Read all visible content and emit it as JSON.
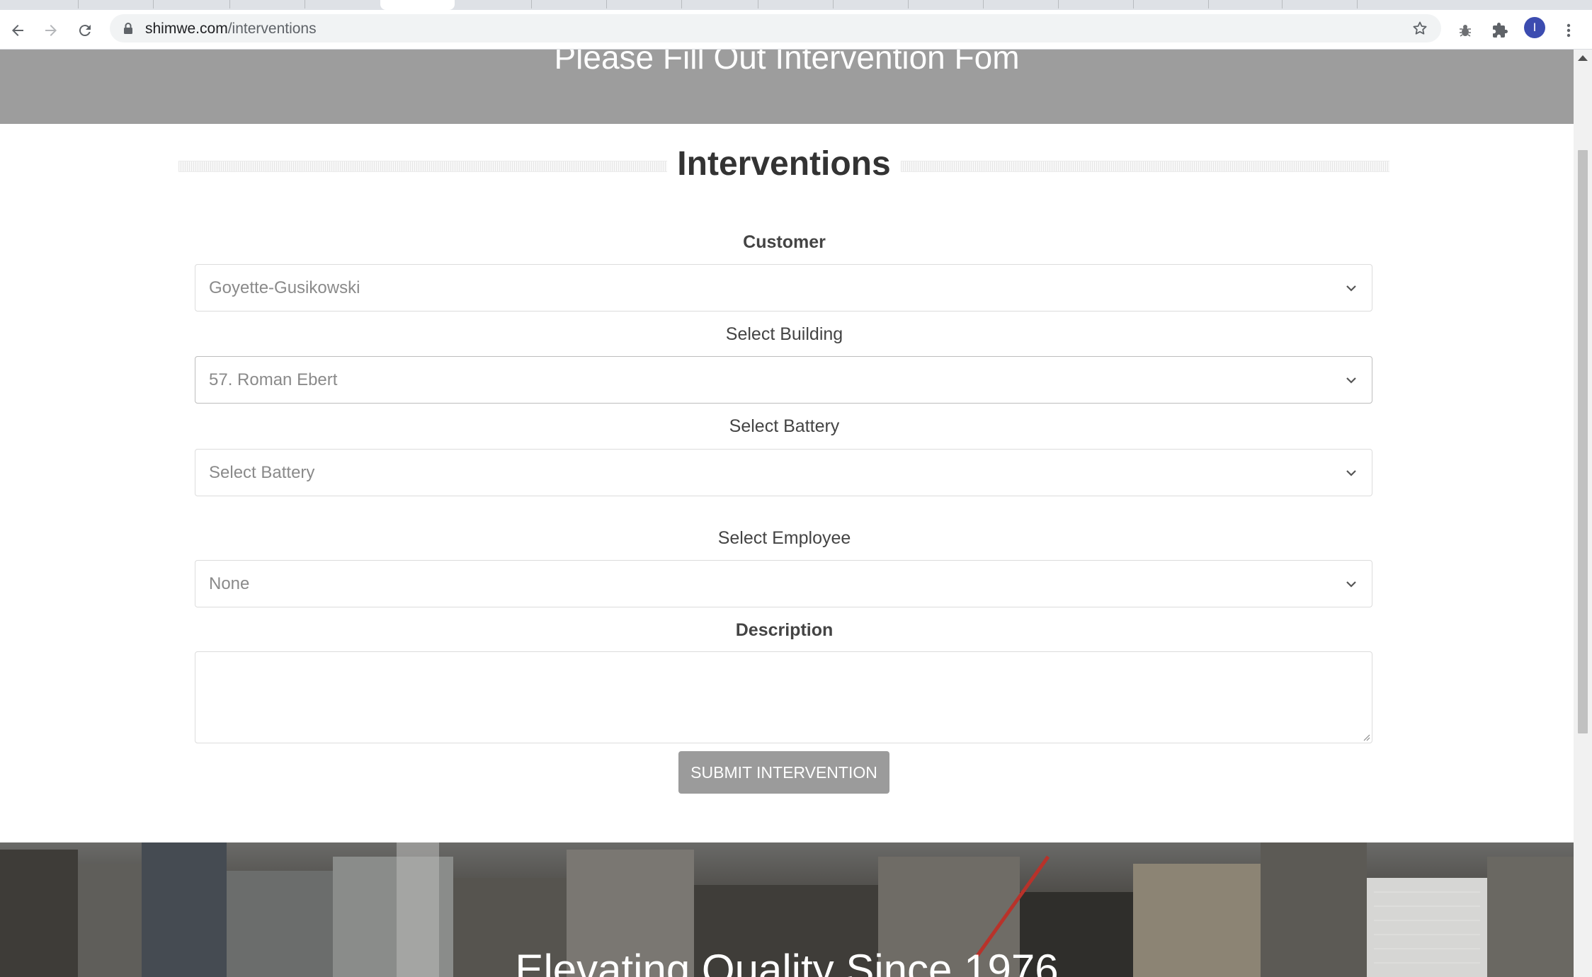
{
  "browser": {
    "url_host": "shimwe.com",
    "url_path": "/interventions",
    "avatar_letter": "I"
  },
  "page": {
    "hero_title": "Please Fill Out Intervention Fom",
    "section_title": "Interventions",
    "form": {
      "customer_label": "Customer",
      "customer_value": "Goyette-Gusikowski",
      "building_label": "Select Building",
      "building_value": "57. Roman Ebert",
      "battery_label": "Select Battery",
      "battery_value": "Select Battery",
      "employee_label": "Select Employee",
      "employee_value": "None",
      "description_label": "Description",
      "description_value": "",
      "submit_label": "SUBMIT INTERVENTION"
    },
    "footer_tagline": "Elevating Quality Since 1976"
  },
  "colors": {
    "hero_band": "#9d9d9d",
    "submit_button": "#9b9b9b",
    "avatar": "#3c4cb0"
  },
  "icons": [
    "back-arrow-icon",
    "forward-arrow-icon",
    "reload-icon",
    "lock-icon",
    "star-icon",
    "bug-extension-icon",
    "puzzle-extensions-icon",
    "kebab-menu-icon",
    "chevron-down-icon"
  ]
}
